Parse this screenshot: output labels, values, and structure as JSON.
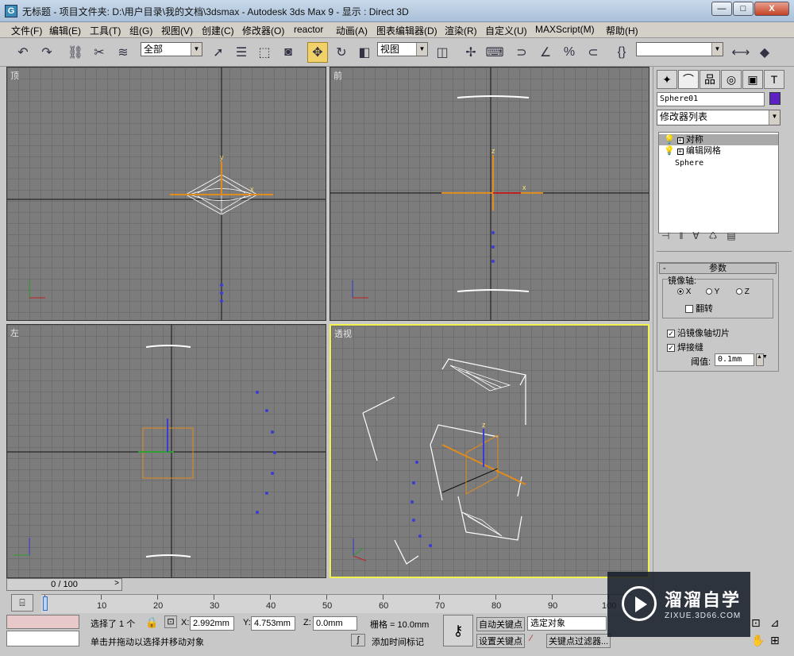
{
  "window": {
    "title": "无标题    - 项目文件夹: D:\\用户目录\\我的文档\\3dsmax    - Autodesk 3ds Max 9    - 显示 : Direct 3D",
    "icon_label": "G",
    "min": "—",
    "max": "□",
    "close": "X"
  },
  "menu": [
    "文件(F)",
    "编辑(E)",
    "工具(T)",
    "组(G)",
    "视图(V)",
    "创建(C)",
    "修改器(O)",
    "reactor",
    "动画(A)",
    "图表编辑器(D)",
    "渲染(R)",
    "自定义(U)",
    "MAXScript(M)",
    "帮助(H)"
  ],
  "toolbar": {
    "selection_filter": "全部",
    "ref_coord": "视图",
    "named_selection": "",
    "icons": [
      "undo-icon",
      "redo-icon",
      "select-link-icon",
      "unlink-icon",
      "bind-spacewarp-icon",
      "select-icon",
      "select-by-name-icon",
      "rect-region-icon",
      "window-crossing-icon",
      "move-icon",
      "rotate-icon",
      "scale-icon",
      "pivot-icon",
      "manipulate-icon",
      "keyboard-shortcut-icon",
      "snap-icon",
      "angle-snap-icon",
      "percent-snap-icon",
      "spinner-snap-icon",
      "edit-named-sel-icon",
      "mirror-icon",
      "align-icon"
    ]
  },
  "viewports": {
    "top": "顶",
    "front": "前",
    "left": "左",
    "perspective": "透视"
  },
  "command_panel": {
    "object_name": "Sphere01",
    "object_color": "#5b22c2",
    "modifier_list": "修改器列表",
    "stack": [
      "对称",
      "编辑网格",
      "Sphere"
    ],
    "params_title": "参数",
    "mirror_axis_label": "镜像轴:",
    "axis_x": "X",
    "axis_y": "Y",
    "axis_z": "Z",
    "flip": "翻转",
    "slice": "沿镜像轴切片",
    "weld": "焊接缝",
    "threshold_label": "阈值:",
    "threshold_value": "0.1mm"
  },
  "timeline": {
    "frame": "0 / 100",
    "ticks": [
      "0",
      "10",
      "20",
      "30",
      "40",
      "50",
      "60",
      "70",
      "80",
      "90",
      "100"
    ]
  },
  "status": {
    "selected": "选择了 1 个",
    "x_label": "X:",
    "x_value": "2.992mm",
    "y_label": "Y:",
    "y_value": "4.753mm",
    "z_label": "Z:",
    "z_value": "0.0mm",
    "grid": "栅格 = 10.0mm",
    "prompt": "单击并拖动以选择并移动对象",
    "add_time_tag": "添加时间标记",
    "auto_key": "自动关键点",
    "set_key": "设置关键点",
    "key_mode": "选定对象",
    "key_filters": "关键点过滤器..."
  },
  "watermark": {
    "brand": "溜溜自学",
    "url": "ZIXUE.3D66.COM"
  }
}
